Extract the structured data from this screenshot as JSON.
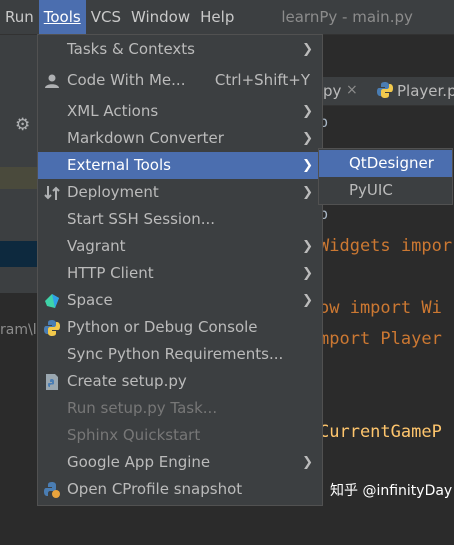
{
  "menubar": {
    "items": [
      "Run",
      "Tools",
      "VCS",
      "Window",
      "Help"
    ],
    "title": "learnPy - main.py"
  },
  "background": {
    "left_text": "ram\\le",
    "tabs": [
      {
        "label": "py",
        "close": "×"
      },
      {
        "label": "Player.p"
      }
    ],
    "code_lines": [
      {
        "text": "p"
      },
      {
        "text": "p"
      },
      {
        "text": "Widgets impor"
      },
      {
        "text": "ow import Wi"
      },
      {
        "text": "mport Player"
      },
      {
        "text": "CurrentGameP"
      }
    ]
  },
  "tools_menu": {
    "items": [
      {
        "label": "Tasks & Contexts",
        "submenu": true
      },
      {
        "label": "Code With Me...",
        "shortcut": "Ctrl+Shift+Y",
        "icon": "code-with-me-icon"
      },
      {
        "label": "XML Actions",
        "submenu": true
      },
      {
        "label": "Markdown Converter",
        "submenu": true
      },
      {
        "label": "External Tools",
        "submenu": true,
        "selected": true
      },
      {
        "label": "Deployment",
        "submenu": true,
        "icon": "deployment-icon"
      },
      {
        "label": "Start SSH Session..."
      },
      {
        "label": "Vagrant",
        "submenu": true
      },
      {
        "label": "HTTP Client",
        "submenu": true
      },
      {
        "label": "Space",
        "submenu": true,
        "icon": "space-icon"
      },
      {
        "label": "Python or Debug Console",
        "icon": "python-icon"
      },
      {
        "label": "Sync Python Requirements..."
      },
      {
        "label": "Create setup.py",
        "icon": "python-file-icon"
      },
      {
        "label": "Run setup.py Task...",
        "disabled": true
      },
      {
        "label": "Sphinx Quickstart",
        "disabled": true
      },
      {
        "label": "Google App Engine",
        "submenu": true
      },
      {
        "label": "Open CProfile snapshot",
        "icon": "profile-icon"
      }
    ]
  },
  "external_tools_submenu": {
    "items": [
      {
        "label": "QtDesigner",
        "selected": true
      },
      {
        "label": "PyUIC"
      }
    ]
  },
  "watermark": "知乎 @infinityDay",
  "colors": {
    "selection": "#4b6eaf",
    "menu_bg": "#3c3f41",
    "editor_bg": "#2b2b2b",
    "keyword": "#cc7832",
    "function": "#ffc66d"
  }
}
